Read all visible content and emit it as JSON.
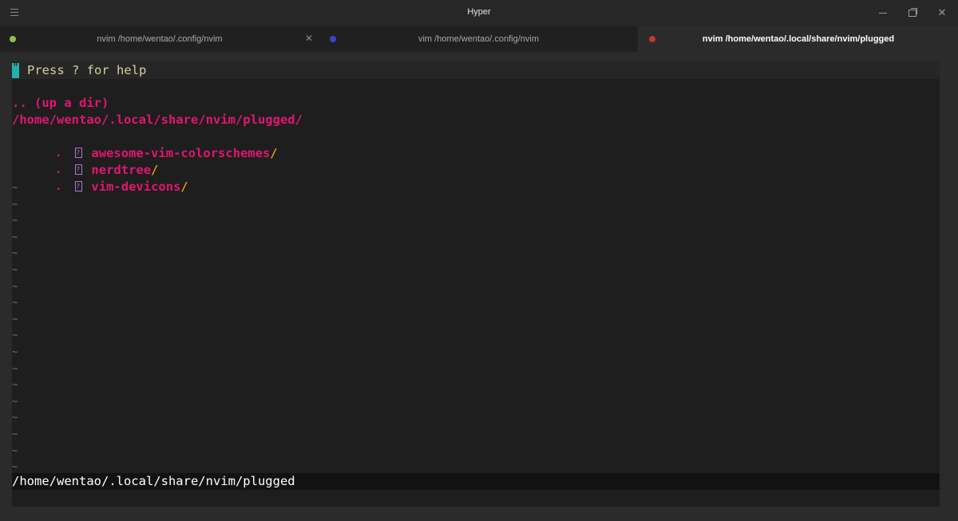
{
  "window": {
    "title": "Hyper",
    "menu_icon": "hamburger-icon",
    "controls": [
      "minimize-icon",
      "maximize-icon",
      "close-icon"
    ],
    "close_glyph": "✕"
  },
  "tabs": [
    {
      "label": "nvim /home/wentao/.config/nvim",
      "dot_color": "#8bc34a",
      "close": "✕",
      "active": false
    },
    {
      "label": "vim /home/wentao/.config/nvim",
      "dot_color": "#3f3fcf",
      "active": false
    },
    {
      "label": "nvim /home/wentao/.local/share/nvim/plugged",
      "dot_color": "#c0392b",
      "active": true
    }
  ],
  "terminal": {
    "cursor_char": "\"",
    "help": "Press ? for help",
    "up_dir": ".. (up a dir)",
    "current_path": "/home/wentao/.local/share/nvim/plugged/",
    "arrow": "▸",
    "entries": [
      {
        "name": "awesome-vim-colorschemes",
        "slash": "/"
      },
      {
        "name": "nerdtree",
        "slash": "/"
      },
      {
        "name": "vim-devicons",
        "slash": "/"
      }
    ],
    "tilde": "~",
    "status": "/home/wentao/.local/share/nvim/plugged"
  },
  "colors": {
    "accent_pink": "#e0166e",
    "slash_yellow": "#ffb000",
    "cursor_teal": "#20b2aa",
    "folder_icon": "#a97bd0"
  }
}
